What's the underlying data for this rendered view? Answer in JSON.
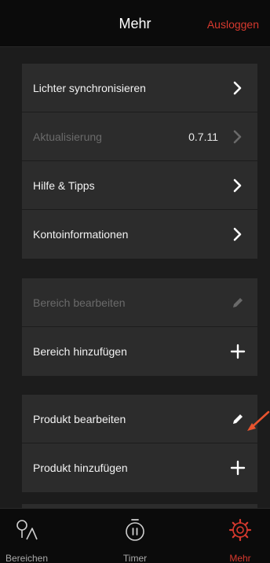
{
  "header": {
    "title": "Mehr",
    "logout_label": "Ausloggen"
  },
  "section1": {
    "items": [
      {
        "label": "Lichter synchronisieren",
        "icon": "chevron-right-icon",
        "disabled": false
      },
      {
        "label": "Aktualisierung",
        "value": "0.7.11",
        "icon": "chevron-right-icon",
        "disabled": true
      },
      {
        "label": "Hilfe & Tipps",
        "icon": "chevron-right-icon",
        "disabled": false
      },
      {
        "label": "Kontoinformationen",
        "icon": "chevron-right-icon",
        "disabled": false
      }
    ]
  },
  "section2": {
    "items": [
      {
        "label": "Bereich bearbeiten",
        "icon": "pencil-icon",
        "disabled": true
      },
      {
        "label": "Bereich hinzufügen",
        "icon": "plus-icon",
        "disabled": false
      }
    ]
  },
  "section3": {
    "items": [
      {
        "label": "Produkt bearbeiten",
        "icon": "pencil-icon",
        "disabled": false
      },
      {
        "label": "Produkt hinzufügen",
        "icon": "plus-icon",
        "disabled": false
      }
    ]
  },
  "tabbar": {
    "tabs": [
      {
        "label": "Bereichen",
        "icon": "room-pin-icon",
        "active": false
      },
      {
        "label": "Timer",
        "icon": "timer-icon",
        "active": false
      },
      {
        "label": "Mehr",
        "icon": "gear-icon",
        "active": true
      }
    ]
  },
  "colors": {
    "accent": "#d6392e",
    "row_bg": "#2c2c2c",
    "background": "#1c1c1c",
    "bar_bg": "#0b0b0b",
    "annotation_arrow": "#e8542f"
  }
}
